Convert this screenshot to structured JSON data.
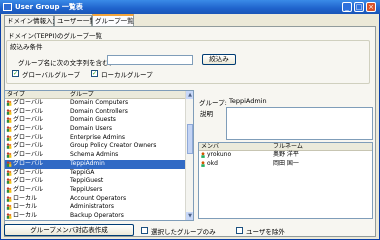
{
  "window": {
    "title": "User Group 一覧表",
    "minimize": "_",
    "maximize": "□",
    "close": "×"
  },
  "tabs": [
    "ドメイン情報入力",
    "ユーザー一覧",
    "グループ一覧"
  ],
  "panel_title": "ドメイン(TEPPI)のグループ一覧",
  "filter": {
    "title": "絞込み条件",
    "contains_label": "グループ名に次の文字列を含む：",
    "contains_value": "",
    "search_button": "絞込み",
    "global_label": "グローバルグループ",
    "local_label": "ローカルグループ",
    "global_checked": true,
    "local_checked": true
  },
  "group_list": {
    "headers": [
      "タイプ",
      "グループ"
    ],
    "rows": [
      {
        "type": "グローバル",
        "name": "Domain Computers",
        "selected": false
      },
      {
        "type": "グローバル",
        "name": "Domain Controllers",
        "selected": false
      },
      {
        "type": "グローバル",
        "name": "Domain Guests",
        "selected": false
      },
      {
        "type": "グローバル",
        "name": "Domain Users",
        "selected": false
      },
      {
        "type": "グローバル",
        "name": "Enterprise Admins",
        "selected": false
      },
      {
        "type": "グローバル",
        "name": "Group Policy Creator Owners",
        "selected": false
      },
      {
        "type": "グローバル",
        "name": "Schema Admins",
        "selected": false
      },
      {
        "type": "グローバル",
        "name": "TeppiAdmin",
        "selected": true
      },
      {
        "type": "グローバル",
        "name": "TeppiGA",
        "selected": false
      },
      {
        "type": "グローバル",
        "name": "TeppiGuest",
        "selected": false
      },
      {
        "type": "グローバル",
        "name": "TeppiUsers",
        "selected": false
      },
      {
        "type": "ローカル",
        "name": "Account Operators",
        "selected": false
      },
      {
        "type": "ローカル",
        "name": "Administrators",
        "selected": false
      },
      {
        "type": "ローカル",
        "name": "Backup Operators",
        "selected": false
      }
    ]
  },
  "detail": {
    "group_label": "グループ:",
    "group_name": "TeppiAdmin",
    "desc_label": "説明",
    "desc_value": "",
    "member_headers": [
      "メンバ",
      "フルネーム"
    ],
    "members": [
      {
        "id": "yrokuno",
        "fullname": "奥野 洋平"
      },
      {
        "id": "okd",
        "fullname": "岡田 国一"
      }
    ]
  },
  "footer": {
    "create_button": "グループメンバ対応表作成",
    "selected_only_label": "選択したグループのみ",
    "exclude_users_label": "ユーザを除外",
    "selected_only_checked": false,
    "exclude_users_checked": false
  }
}
